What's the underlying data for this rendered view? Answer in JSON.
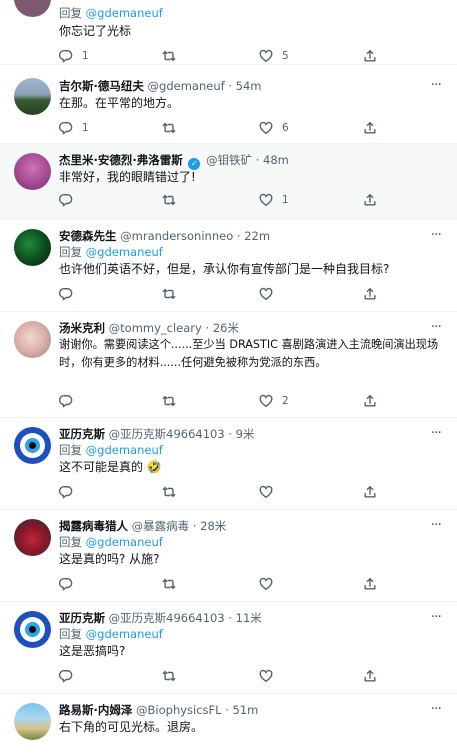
{
  "tweets": [
    {
      "name": "",
      "handle": "",
      "time": "",
      "reply_prefix": "回复",
      "reply_to": "@gdemaneuf",
      "text": "你忘记了光标",
      "replies": "1",
      "retweets": "",
      "likes": "5"
    },
    {
      "name": "吉尔斯·德马纽夫",
      "handle": "@gdemaneuf",
      "time": "54m",
      "text": "在那。在平常的地方。",
      "replies": "1",
      "retweets": "",
      "likes": "6"
    },
    {
      "name": "杰里米·安德烈·弗洛雷斯",
      "handle": "@钼铁矿",
      "time": "48m",
      "text": "非常好，我的眼睛错过了!",
      "replies": "",
      "retweets": "",
      "likes": "1"
    },
    {
      "name": "安德森先生",
      "handle": "@mrandersoninneo",
      "time": "22m",
      "reply_prefix": "回复",
      "reply_to": "@gdemaneuf",
      "text": "也许他们英语不好，但是，承认你有宣传部门是一种自我目标?",
      "replies": "",
      "retweets": "",
      "likes": ""
    },
    {
      "name": "汤米克利",
      "handle": "@tommy_cleary",
      "time": "26米",
      "text_line1": "谢谢你。需要阅读这个......至少当 DRASTIC 喜剧路演进入主流晚间演出现场",
      "text_line2": "时，你有更多的材料......任何避免被称为党派的东西。",
      "replies": "",
      "retweets": "",
      "likes": "2"
    },
    {
      "name": "亚历克斯",
      "handle": "@亚历克斯49664103",
      "time": "9米",
      "reply_prefix": "回复",
      "reply_to": "@gdemaneuf",
      "text": "这不可能是真的",
      "emoji": "🤣",
      "replies": "",
      "retweets": "",
      "likes": ""
    },
    {
      "name": "揭露病毒猎人",
      "handle": "@暴露病毒",
      "time": "28米",
      "reply_prefix": "回复",
      "reply_to": "@gdemaneuf",
      "text": "这是真的吗? 从施?",
      "replies": "",
      "retweets": "",
      "likes": ""
    },
    {
      "name": "亚历克斯",
      "handle": "@亚历克斯49664103",
      "time": "11米",
      "reply_prefix": "回复",
      "reply_to": "@gdemaneuf",
      "text": "这是恶搞吗?",
      "replies": "",
      "retweets": "",
      "likes": ""
    },
    {
      "name": "路易斯·内姆泽",
      "handle": "@BiophysicsFL",
      "time": "51m",
      "text": "右下角的可见光标。退房。",
      "replies": "",
      "retweets": "",
      "likes": ""
    }
  ],
  "time_sep": "·",
  "more_glyph": "···",
  "colors": {
    "accent": "#1d9bf0",
    "text": "#0f1419",
    "muted": "#536471",
    "divider": "#eff3f4"
  },
  "icons": [
    "reply-icon",
    "retweet-icon",
    "like-icon",
    "share-icon",
    "more-icon",
    "verified-badge-icon"
  ]
}
